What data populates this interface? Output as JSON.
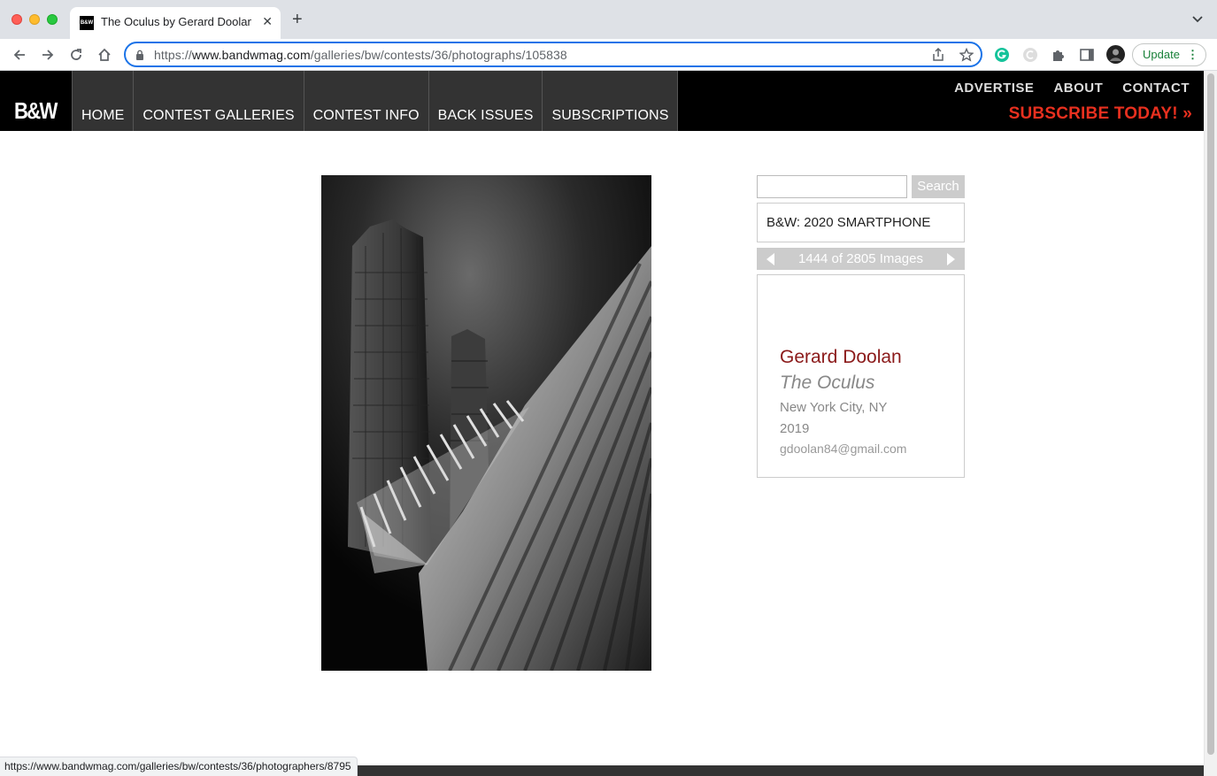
{
  "browser": {
    "tab_title": "The Oculus by Gerard Doolan | B&W",
    "tab_favicon": "B&W",
    "url_prefix": "https://",
    "url_host": "www.bandwmag.com",
    "url_path": "/galleries/bw/contests/36/photographs/105838",
    "update_label": "Update",
    "status_url": "https://www.bandwmag.com/galleries/bw/contests/36/photographers/8795"
  },
  "site": {
    "logo": "B&W",
    "main_nav": [
      "HOME",
      "CONTEST GALLERIES",
      "CONTEST INFO",
      "BACK ISSUES",
      "SUBSCRIPTIONS"
    ],
    "top_nav": [
      "ADVERTISE",
      "ABOUT",
      "CONTACT"
    ],
    "subscribe": "SUBSCRIBE TODAY! »"
  },
  "sidebar": {
    "search_value": "",
    "search_button": "Search",
    "contest_name": "B&W: 2020 SMARTPHONE",
    "pager_text": "1444 of 2805 Images",
    "photographer": "Gerard Doolan",
    "photo_title": "The Oculus",
    "location": "New York City, NY",
    "year": "2019",
    "email": "gdoolan84@gmail.com"
  },
  "icons": {
    "back": "back-arrow-icon",
    "forward": "forward-arrow-icon",
    "reload": "reload-icon",
    "home": "home-icon",
    "lock": "lock-icon",
    "share": "share-icon",
    "bookmark": "star-icon"
  },
  "colors": {
    "accent_red": "#e8301f",
    "photographer_red": "#8b1a1a",
    "omnibox_focus": "#1a73e8"
  }
}
